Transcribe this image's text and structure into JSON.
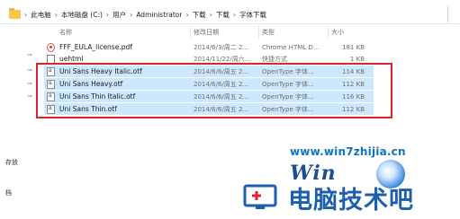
{
  "breadcrumb": {
    "items": [
      "此电脑",
      "本地磁盘 (C:)",
      "用户",
      "Administrator",
      "下载",
      "下载",
      "字体下载"
    ]
  },
  "columns": {
    "name": "名称",
    "date": "修改日期",
    "type": "类型",
    "size": "大小"
  },
  "nav": {
    "items": [
      "存放",
      "档"
    ]
  },
  "files": [
    {
      "name": "FFF_EULA_license.pdf",
      "date": "2014/6/3/周二 2...",
      "type": "Chrome HTML D...",
      "size": "181 KB",
      "icon": "pdf-icon",
      "selected": false
    },
    {
      "name": "uehtml",
      "date": "2014/11/22/周六...",
      "type": "快捷方式",
      "size": "1 KB",
      "icon": "shortcut-icon",
      "selected": false
    },
    {
      "name": "Uni Sans Heavy Italic.otf",
      "date": "2014/6/6/周五 2...",
      "type": "OpenType 字体...",
      "size": "114 KB",
      "icon": "font-file-icon",
      "selected": true
    },
    {
      "name": "Uni Sans Heavy.otf",
      "date": "2014/6/6/周五 2...",
      "type": "OpenType 字体...",
      "size": "112 KB",
      "icon": "font-file-icon",
      "selected": true
    },
    {
      "name": "Uni Sans Thin Italic.otf",
      "date": "2014/6/6/周五 2...",
      "type": "OpenType 字体...",
      "size": "116 KB",
      "icon": "font-file-icon",
      "selected": true
    },
    {
      "name": "Uni Sans Thin.otf",
      "date": "2014/6/6/周五 2...",
      "type": "OpenType 字体...",
      "size": "112 KB",
      "icon": "font-file-icon",
      "selected": true
    }
  ],
  "watermark": {
    "url": "www.win7zhijia.cn",
    "win": "Win",
    "slogan": "电脑技术吧"
  },
  "colors": {
    "selection": "#cce8ff",
    "highlight_box": "#e0232d",
    "watermark_blue": "#1c5fae"
  }
}
